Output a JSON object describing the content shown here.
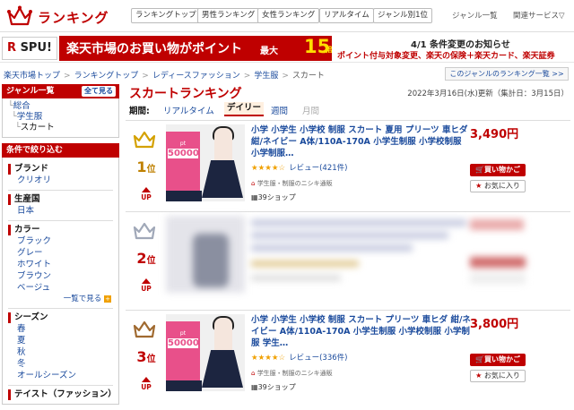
{
  "header": {
    "logo_text": "ランキング",
    "tabs": [
      "ランキングトップ",
      "男性ランキング",
      "女性ランキング",
      "リアルタイム",
      "ジャンル別1位"
    ],
    "menu": [
      "ジャンル一覧",
      "関連サービス▽"
    ]
  },
  "banner": {
    "spu_r": "R",
    "spu_rest": " SPU!",
    "main_text": "楽天市場のお買い物がポイント",
    "max_text": "最大",
    "times_num": "15",
    "times_suffix": "倍",
    "notice_title": "4/1 条件変更のお知らせ",
    "notice_body": "ポイント付与対象変更、楽天の保険＋楽天カード、楽天証券"
  },
  "breadcrumb": [
    "楽天市場トップ",
    "ランキングトップ",
    "レディースファッション",
    "学生服",
    "スカート"
  ],
  "genre_ranking_link": "このジャンルのランキング一覧 >>",
  "sidebar": {
    "genre_header": "ジャンル一覧",
    "view_all": "全て見る",
    "genres": [
      "総合",
      "学生服",
      "スカート"
    ],
    "filter_header": "条件で絞り込む",
    "sections": [
      {
        "title": "ブランド",
        "items": [
          "クリオリ"
        ]
      },
      {
        "title": "生産国",
        "items": [
          "日本"
        ]
      },
      {
        "title": "カラー",
        "items": [
          "ブラック",
          "グレー",
          "ホワイト",
          "ブラウン",
          "ベージュ"
        ],
        "more": "一覧で見る"
      },
      {
        "title": "シーズン",
        "items": [
          "春",
          "夏",
          "秋",
          "冬",
          "オールシーズン"
        ]
      },
      {
        "title": "テイスト（ファッション）",
        "items": []
      }
    ]
  },
  "main": {
    "title": "スカートランキング",
    "updated": "2022年3月16日(水)更新（集計日：3月15日）",
    "period_label": "期間:",
    "period_tabs": [
      "リアルタイム",
      "デイリー",
      "週間",
      "月間"
    ],
    "period_active": "デイリー",
    "items": [
      {
        "rank": "1",
        "rank_suffix": "位",
        "crown_color": "#d4a100",
        "up": "UP",
        "thumb_badge": "50000",
        "title": "小学 小学生 小学校 制服 スカート 夏用 プリーツ 車ヒダ 紺/ネイビー A体/110A-170A 小学生制服 小学校制服 小学制服…",
        "stars": "★★★★☆",
        "reviews": "レビュー(421件)",
        "shop": "学生服・制服のニシキ通販",
        "shops": "39ショップ",
        "price": "3,490円",
        "cart": "買い物かご",
        "fav": "お気に入り"
      },
      {
        "rank": "2",
        "rank_suffix": "位",
        "crown_color": "#a0a8b8",
        "up": "UP",
        "blurred": true
      },
      {
        "rank": "3",
        "rank_suffix": "位",
        "crown_color": "#a06a30",
        "up": "UP",
        "thumb_badge": "50000",
        "title": "小学 小学生 小学校 制服 スカート プリーツ 車ヒダ 紺/ネイビー A体/110A-170A 小学生制服 小学校制服 小学制服 学生…",
        "stars": "★★★★☆",
        "reviews": "レビュー(336件)",
        "shop": "学生服・制服のニシキ通販",
        "shops": "39ショップ",
        "price": "3,800円",
        "cart": "買い物かご",
        "fav": "お気に入り"
      }
    ]
  }
}
